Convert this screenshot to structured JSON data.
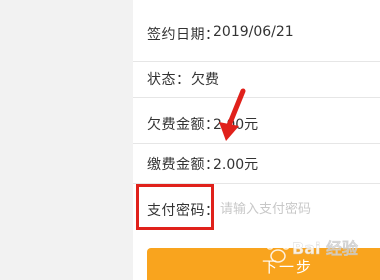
{
  "details": {
    "sign_date": {
      "label": "签约日期：",
      "value": "2019/06/21"
    },
    "status": {
      "label": "状态：",
      "value": "欠费"
    },
    "owed_amount": {
      "label": "欠费金额：",
      "value": "2.00元"
    },
    "pay_amount": {
      "label": "缴费金额：",
      "value": "2.00元"
    }
  },
  "payment_password": {
    "label": "支付密码：",
    "placeholder": "请输入支付密码"
  },
  "next_button": {
    "label": "下一步"
  },
  "watermark": {
    "text": "Bai 经验"
  },
  "colors": {
    "accent": "#f9a41e",
    "highlight": "#e0211b",
    "text": "#333333",
    "placeholder": "#c8c8c8",
    "side_bg": "#f2f2f2"
  },
  "icons": [
    "red-arrow-annotation-icon",
    "baidu-paw-logo-icon"
  ]
}
